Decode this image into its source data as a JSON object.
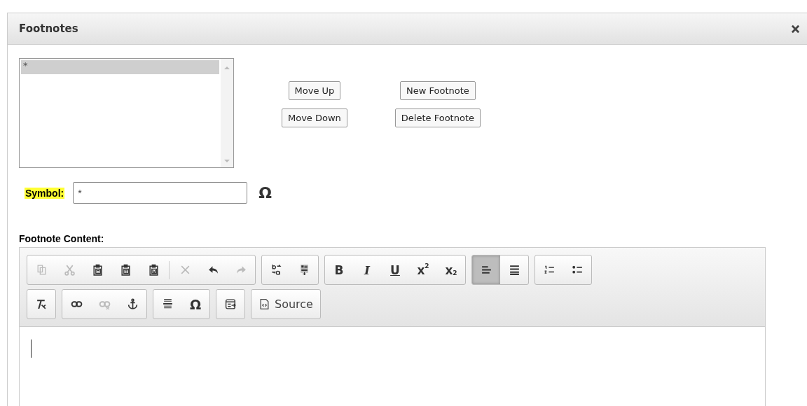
{
  "window": {
    "title": "Footnotes"
  },
  "footnote_list": {
    "items": [
      {
        "text": "*",
        "selected": true
      }
    ]
  },
  "buttons": [
    {
      "label": "Move Up"
    },
    {
      "label": "New Footnote"
    },
    {
      "label": "Move Down"
    },
    {
      "label": "Delete Footnote"
    }
  ],
  "symbol": {
    "label": "Symbol:",
    "value": "*",
    "picker": "Ω"
  },
  "content": {
    "label": "Footnote Content:"
  },
  "toolbar": [
    [
      {
        "buttons": [
          {
            "kind": "copy",
            "disabled": true,
            "on": false
          },
          {
            "kind": "cut",
            "disabled": true,
            "on": false
          },
          {
            "kind": "paste",
            "disabled": false,
            "on": false
          },
          {
            "kind": "paste-text",
            "disabled": false,
            "on": false
          },
          {
            "kind": "paste-word",
            "disabled": false,
            "on": false
          },
          {
            "kind": "separator"
          },
          {
            "kind": "remove",
            "disabled": true,
            "on": false
          },
          {
            "kind": "undo",
            "disabled": false,
            "on": false
          },
          {
            "kind": "redo",
            "disabled": true,
            "on": false
          }
        ]
      },
      {
        "buttons": [
          {
            "kind": "replace",
            "disabled": false,
            "on": false
          },
          {
            "kind": "select-all",
            "disabled": false,
            "on": false
          }
        ]
      },
      {
        "buttons": [
          {
            "kind": "bold",
            "label": "B",
            "disabled": false,
            "on": false
          },
          {
            "kind": "italic",
            "label": "I",
            "disabled": false,
            "on": false
          },
          {
            "kind": "underline",
            "label": "U",
            "disabled": false,
            "on": false
          },
          {
            "kind": "superscript",
            "label": "x",
            "mark": "2",
            "disabled": false,
            "on": false
          },
          {
            "kind": "subscript",
            "label": "x",
            "mark": "2",
            "disabled": false,
            "on": false
          }
        ]
      },
      {
        "buttons": [
          {
            "kind": "align-left",
            "disabled": false,
            "on": true
          },
          {
            "kind": "justify",
            "disabled": false,
            "on": false
          }
        ]
      },
      {
        "buttons": [
          {
            "kind": "numbered-list",
            "disabled": false,
            "on": false
          },
          {
            "kind": "bulleted-list",
            "disabled": false,
            "on": false
          }
        ]
      }
    ],
    [
      {
        "buttons": [
          {
            "kind": "clear-format",
            "disabled": false,
            "on": false
          }
        ]
      },
      {
        "buttons": [
          {
            "kind": "link",
            "disabled": false,
            "on": false
          },
          {
            "kind": "unlink",
            "disabled": true,
            "on": false
          },
          {
            "kind": "anchor",
            "disabled": false,
            "on": false
          }
        ]
      },
      {
        "buttons": [
          {
            "kind": "rule",
            "disabled": false,
            "on": false
          },
          {
            "kind": "symbol",
            "label": "Ω",
            "disabled": false,
            "on": false
          }
        ]
      },
      {
        "buttons": [
          {
            "kind": "embed",
            "disabled": false,
            "on": false
          }
        ]
      },
      {
        "buttons": [
          {
            "kind": "source",
            "label": "Source",
            "disabled": false,
            "on": false
          }
        ]
      }
    ]
  ]
}
